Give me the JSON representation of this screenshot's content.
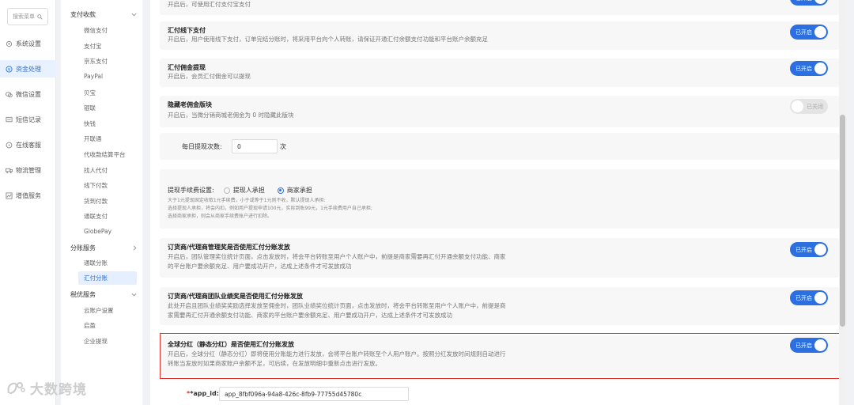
{
  "search": {
    "placeholder": "搜索菜单"
  },
  "nav": [
    {
      "label": "系统设置",
      "icon": "gear-icon"
    },
    {
      "label": "资金处理",
      "icon": "money-icon"
    },
    {
      "label": "微信设置",
      "icon": "wechat-icon"
    },
    {
      "label": "短信记录",
      "icon": "message-icon"
    },
    {
      "label": "在线客服",
      "icon": "service-icon"
    },
    {
      "label": "物流管理",
      "icon": "truck-icon"
    },
    {
      "label": "增值服务",
      "icon": "chart-icon"
    }
  ],
  "subnav": {
    "group1": "支付收款",
    "items1": [
      "微信支付",
      "支付宝",
      "京东支付",
      "PayPal",
      "贝宝",
      "银联",
      "快钱",
      "开联通",
      "代收款结算平台",
      "找人代付",
      "线下付款",
      "货到付款",
      "通联支付",
      "GlobePay"
    ],
    "group2": "分账服务",
    "items2": [
      "通联分账",
      "汇付分账"
    ],
    "group3": "税优服务",
    "items3": [
      "云账户设置",
      "启盈",
      "企业提现"
    ]
  },
  "cards": {
    "c0_desc": "开启后，可使用汇付支付宝支付",
    "c1_title": "汇付线下支付",
    "c1_desc": "开启后，用户使用线下支付，订单完结分账时，将采用平台向个人转账，请保证开通汇付余额支付功能和平台账户余额充足",
    "c2_title": "汇付佣金提现",
    "c2_desc": "开启后，会员汇付佣金可以提现",
    "c3_title": "隐藏老佣金版块",
    "c3_desc": "开启后，当微分销商城老佣金为 0 时隐藏此版块",
    "withdraw_label": "每日提现次数:",
    "withdraw_value": "0",
    "withdraw_unit": "次",
    "fee_label": "提现手续费设置:",
    "fee_opt1": "提现人承担",
    "fee_opt2": "商家承担",
    "fee_note1": "大于1元提现固定收取1元手续费，小于或等于1元则不收，默认提现人承担:",
    "fee_note2": "选择提现人承担，将会内扣，例如用户提现申请100元，实际到账99元，1元手续费用户自己承担;",
    "fee_note3": "选择商家承担，则会从商家手续费账户进行扣除。",
    "c5_title": "订货商/代理商管理奖是否使用汇付分账发放",
    "c5_desc1": "开启后，团队管理奖位统计页面，点击发放时，将会平台转账至用户个人账户中，前提是商家需要再汇付开通余额支付功能、商家",
    "c5_desc2": "的平台账户要余额充足、用户要成功开户，达成上述条件才可发放成功",
    "c6_title": "订货商/代理商团队业绩奖是否使用汇付分账发放",
    "c6_desc1": "此处开启且团队业绩奖奖励选择发放至佣金时，团队业绩奖位统计页面，点击发放时，将会平台转账至用户个人账户中，前提是商",
    "c6_desc2": "家需要再汇付开通余额支付功能、商家的平台账户要余额充足、用户要成功开户，达成上述条件才可发放成功",
    "c7_title": "全球分红（静态分红）是否使用汇付分账发放",
    "c7_desc1": "开启后，全球分红（静态分红）即将使用分账能力进行发放，会将平台账户转账至个人用户账户。按照分红发放时间规则自动进行",
    "c7_desc2": "转账当发放时如果商家账户余额不足，可后续，在发放明细中重新点击进行发放。",
    "appid_label": "*app_id:",
    "appid_value": "app_8fbf096a-94a8-426c-8fb9-77755d45780c"
  },
  "toggle_on": "已开启",
  "toggle_off": "已关闭",
  "watermark": "大数跨境",
  "colors": {
    "accent": "#2b6fe0",
    "highlight": "#d9342b"
  }
}
